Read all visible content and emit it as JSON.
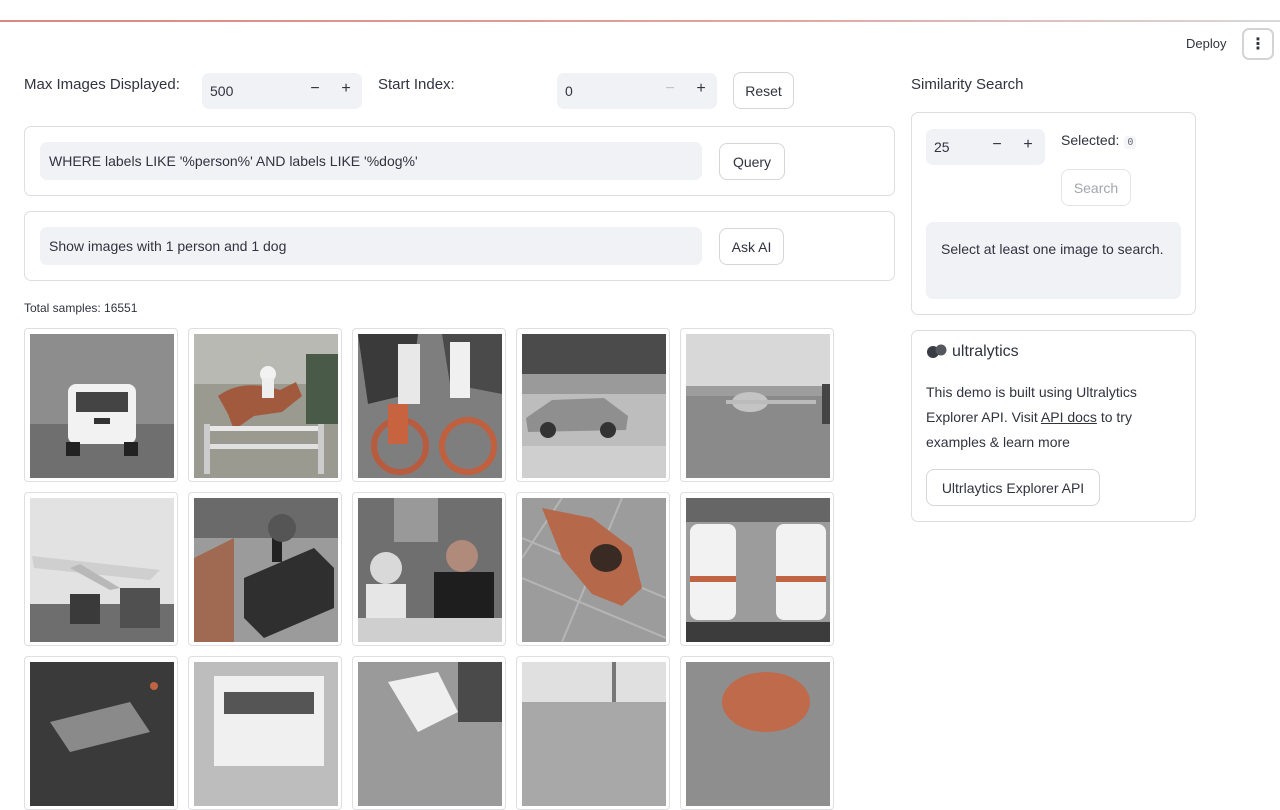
{
  "header": {
    "deploy_label": "Deploy",
    "menu_icon": "kebab-menu-icon"
  },
  "controls": {
    "max_images_label": "Max Images Displayed:",
    "max_images_value": "500",
    "start_index_label": "Start Index:",
    "start_index_value": "0",
    "reset_label": "Reset",
    "minus": "−",
    "plus": "+"
  },
  "query": {
    "value": "WHERE labels LIKE '%person%' AND labels LIKE '%dog%'",
    "button": "Query"
  },
  "ask_ai": {
    "value": "Show images with 1 person and 1 dog",
    "button": "Ask AI"
  },
  "results": {
    "total_label": "Total samples: 16551"
  },
  "images": [
    {
      "subject": "white car"
    },
    {
      "subject": "horse jumping"
    },
    {
      "subject": "cyclists"
    },
    {
      "subject": "silver sedan"
    },
    {
      "subject": "airplane on runway"
    },
    {
      "subject": "parked airplane"
    },
    {
      "subject": "steam train"
    },
    {
      "subject": "two people at table"
    },
    {
      "subject": "dog on ground"
    },
    {
      "subject": "two trains"
    },
    {
      "subject": "dark scene"
    },
    {
      "subject": "truck front"
    },
    {
      "subject": "person with dog"
    },
    {
      "subject": "landscape"
    },
    {
      "subject": "close-up"
    }
  ],
  "similarity": {
    "title": "Similarity Search",
    "count_value": "25",
    "selected_label": "Selected:",
    "selected_count": "0",
    "search_button": "Search",
    "hint": "Select at least one image to search."
  },
  "about": {
    "brand": "ultralytics",
    "text_before": "This demo is built using Ultralytics Explorer API. Visit ",
    "link": "API docs",
    "text_after": " to try examples & learn more",
    "button": "Ultrlaytics Explorer API"
  }
}
